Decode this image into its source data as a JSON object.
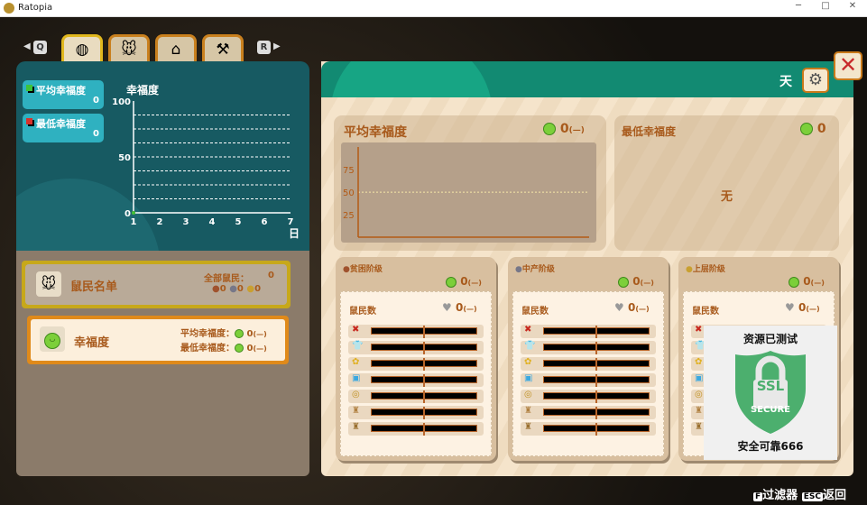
{
  "window": {
    "title": "Ratopia",
    "minimize": "─",
    "maximize": "□",
    "close": "✕"
  },
  "nav": {
    "prev_key": "Q",
    "next_key": "R",
    "tabs": [
      {
        "icon": "coin-icon",
        "glyph": "◍"
      },
      {
        "icon": "rat-icon",
        "glyph": "🐭"
      },
      {
        "icon": "house-icon",
        "glyph": "⌂"
      },
      {
        "icon": "tools-icon",
        "glyph": "⚒"
      }
    ],
    "active_tab": 0
  },
  "legend": [
    {
      "label": "平均幸福度",
      "value": "0",
      "color": "#3ec43a"
    },
    {
      "label": "最低幸福度",
      "value": "0",
      "color": "#d8322c"
    }
  ],
  "chart_data": {
    "type": "line",
    "title": "幸福度",
    "xlabel": "日",
    "x_ticks": [
      "1",
      "2",
      "3",
      "4",
      "5",
      "6",
      "7"
    ],
    "y_ticks": [
      "0",
      "50",
      "100"
    ],
    "ylim": [
      0,
      100
    ],
    "xlim": [
      1,
      7
    ],
    "grid": true,
    "series": [
      {
        "name": "平均幸福度",
        "x": [
          1
        ],
        "values": [
          0
        ],
        "color": "#3ec43a"
      },
      {
        "name": "最低幸福度",
        "x": [
          1
        ],
        "values": [
          0
        ],
        "color": "#d8322c"
      }
    ]
  },
  "menu": {
    "roster": {
      "title": "鼠民名单",
      "all_label": "全部鼠民：",
      "all_value": "0",
      "poor": "0",
      "middle": "0",
      "upper": "0"
    },
    "happiness": {
      "title": "幸福度",
      "avg_label": "平均幸福度：",
      "avg_value": "0",
      "avg_change": "(—)",
      "min_label": "最低幸福度：",
      "min_value": "0",
      "min_change": "(—)"
    }
  },
  "right": {
    "period": "天",
    "avg": {
      "title": "平均幸福度",
      "value": "0",
      "change": "(—)",
      "y_ticks": [
        "75",
        "50",
        "25"
      ],
      "reference": 50
    },
    "min": {
      "title": "最低幸福度",
      "value": "0",
      "empty": "无"
    },
    "classes": [
      {
        "name": "贫困阶级",
        "value": "0",
        "change": "(—)",
        "pop_label": "鼠民数",
        "pop": "0",
        "pop_change": "(—)"
      },
      {
        "name": "中产阶级",
        "value": "0",
        "change": "(—)",
        "pop_label": "鼠民数",
        "pop": "0",
        "pop_change": "(—)"
      },
      {
        "name": "上层阶级",
        "value": "0",
        "change": "(—)",
        "pop_label": "鼠民数",
        "pop": "0",
        "pop_change": "(—)"
      }
    ],
    "needs": [
      {
        "icon": "food-icon",
        "glyph": "✖",
        "color": "#c8281e"
      },
      {
        "icon": "clothing-icon",
        "glyph": "👕",
        "color": "#1d5fc8"
      },
      {
        "icon": "entertainment-icon",
        "glyph": "✿",
        "color": "#e0b020"
      },
      {
        "icon": "hygiene-icon",
        "glyph": "▣",
        "color": "#3aa8e0"
      },
      {
        "icon": "coin-icon",
        "glyph": "◎",
        "color": "#c09020"
      },
      {
        "icon": "money-bag-icon",
        "glyph": "♜",
        "color": "#b08040"
      },
      {
        "icon": "wealth-bag-icon",
        "glyph": "♜",
        "color": "#9a7030"
      }
    ]
  },
  "overlay": {
    "title": "资源已测试",
    "badge_main": "SSL",
    "badge_sub": "SECURE",
    "caption": "安全可靠666",
    "color": "#4caf6e"
  },
  "footer": {
    "filter_key": "F",
    "filter_label": "过滤器",
    "back_key": "ESC",
    "back_label": "返回"
  }
}
